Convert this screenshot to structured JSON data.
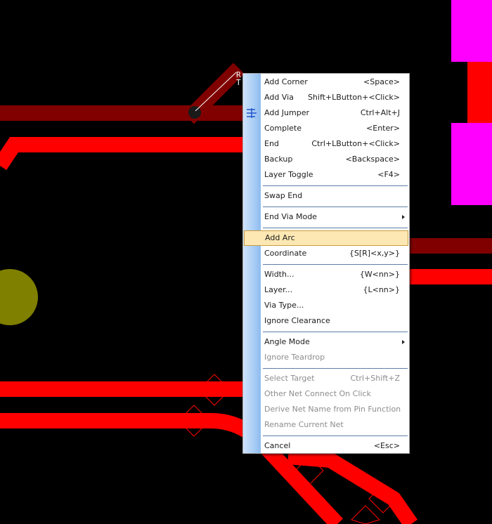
{
  "colors": {
    "background": "#000000",
    "trace_red": "#ff0000",
    "trace_dark_red": "#800000",
    "pad_magenta": "#ff00ff",
    "via_olive": "#7f7f00",
    "menu_highlight": "#fde8b4"
  },
  "hint": {
    "line1": "R",
    "line2": "T"
  },
  "menu": {
    "items": [
      {
        "label": "Add Corner",
        "shortcut": "<Space>"
      },
      {
        "label": "Add Via",
        "shortcut": "Shift+LButton+<Click>"
      },
      {
        "label": "Add Jumper",
        "shortcut": "Ctrl+Alt+J",
        "icon": "jumper-icon"
      },
      {
        "label": "Complete",
        "shortcut": "<Enter>"
      },
      {
        "label": "End",
        "shortcut": "Ctrl+LButton+<Click>"
      },
      {
        "label": "Backup",
        "shortcut": "<Backspace>"
      },
      {
        "label": "Layer Toggle",
        "shortcut": "<F4>"
      },
      {
        "label": "Swap End",
        "shortcut": ""
      },
      {
        "label": "End Via Mode",
        "shortcut": "",
        "submenu": true
      },
      {
        "label": "Add Arc",
        "shortcut": "",
        "highlighted": true
      },
      {
        "label": "Coordinate",
        "shortcut": "{S[R]<x,y>}"
      },
      {
        "label": "Width...",
        "shortcut": "{W<nn>}"
      },
      {
        "label": "Layer...",
        "shortcut": "{L<nn>}"
      },
      {
        "label": "Via Type...",
        "shortcut": ""
      },
      {
        "label": "Ignore Clearance",
        "shortcut": ""
      },
      {
        "label": "Angle Mode",
        "shortcut": "",
        "submenu": true
      },
      {
        "label": "Ignore Teardrop",
        "shortcut": "",
        "disabled": true
      },
      {
        "label": "Select Target",
        "shortcut": "Ctrl+Shift+Z",
        "disabled": true
      },
      {
        "label": "Other Net Connect On Click",
        "shortcut": "",
        "disabled": true
      },
      {
        "label": "Derive Net Name from Pin Function",
        "shortcut": "",
        "disabled": true
      },
      {
        "label": "Rename Current Net",
        "shortcut": "",
        "disabled": true
      },
      {
        "label": "Cancel",
        "shortcut": "<Esc>"
      }
    ]
  }
}
